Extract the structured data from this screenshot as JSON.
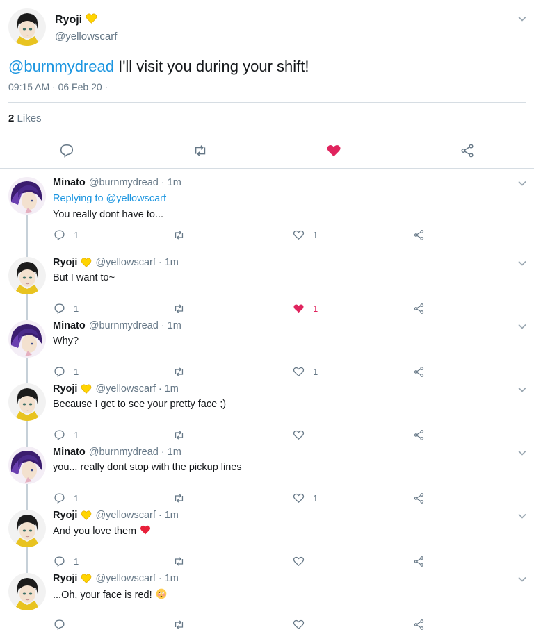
{
  "tweet": {
    "author_name": "Ryoji",
    "author_handle": "@yellowscarf",
    "mention": "@burnmydread",
    "text": " I'll visit you during your shift!",
    "timestamp": "09:15 AM · 06 Feb 20 ·",
    "likes_count": "2",
    "likes_label": "Likes",
    "liked": true
  },
  "colors": {
    "accent": "#1b95e0",
    "like": "#e0245e",
    "muted": "#657786",
    "divider": "#d6dde3",
    "badge": "#ffd400"
  },
  "replies": [
    {
      "author": "ryoji-hidden-skip",
      "name": "Minato",
      "handle": "@burnmydread",
      "sep": "·",
      "time": "1m",
      "replying_label": "Replying to",
      "replying_to": "@yellowscarf",
      "text": "You really dont have to...",
      "reply_count": "1",
      "like_count": "1",
      "liked": false
    },
    {
      "name": "Ryoji",
      "handle": "@yellowscarf",
      "sep": "·",
      "time": "1m",
      "text": "But I want to~",
      "reply_count": "1",
      "like_count": "1",
      "liked": true
    },
    {
      "name": "Minato",
      "handle": "@burnmydread",
      "sep": "·",
      "time": "1m",
      "text": "Why?",
      "reply_count": "1",
      "like_count": "1",
      "liked": false
    },
    {
      "name": "Ryoji",
      "handle": "@yellowscarf",
      "sep": "·",
      "time": "1m",
      "text": "Because I get to see your pretty face ;)",
      "reply_count": "1",
      "like_count": "",
      "liked": false
    },
    {
      "name": "Minato",
      "handle": "@burnmydread",
      "sep": "·",
      "time": "1m",
      "text": "you... really dont stop with the pickup lines",
      "reply_count": "1",
      "like_count": "1",
      "liked": false
    },
    {
      "name": "Ryoji",
      "handle": "@yellowscarf",
      "sep": "·",
      "time": "1m",
      "text": "And you love them",
      "emoji": "heart",
      "reply_count": "1",
      "like_count": "",
      "liked": false
    },
    {
      "name": "Ryoji",
      "handle": "@yellowscarf",
      "sep": "·",
      "time": "1m",
      "text": "...Oh, your face is red!",
      "emoji": "flushed-face",
      "reply_count": "",
      "like_count": "",
      "liked": false
    }
  ]
}
